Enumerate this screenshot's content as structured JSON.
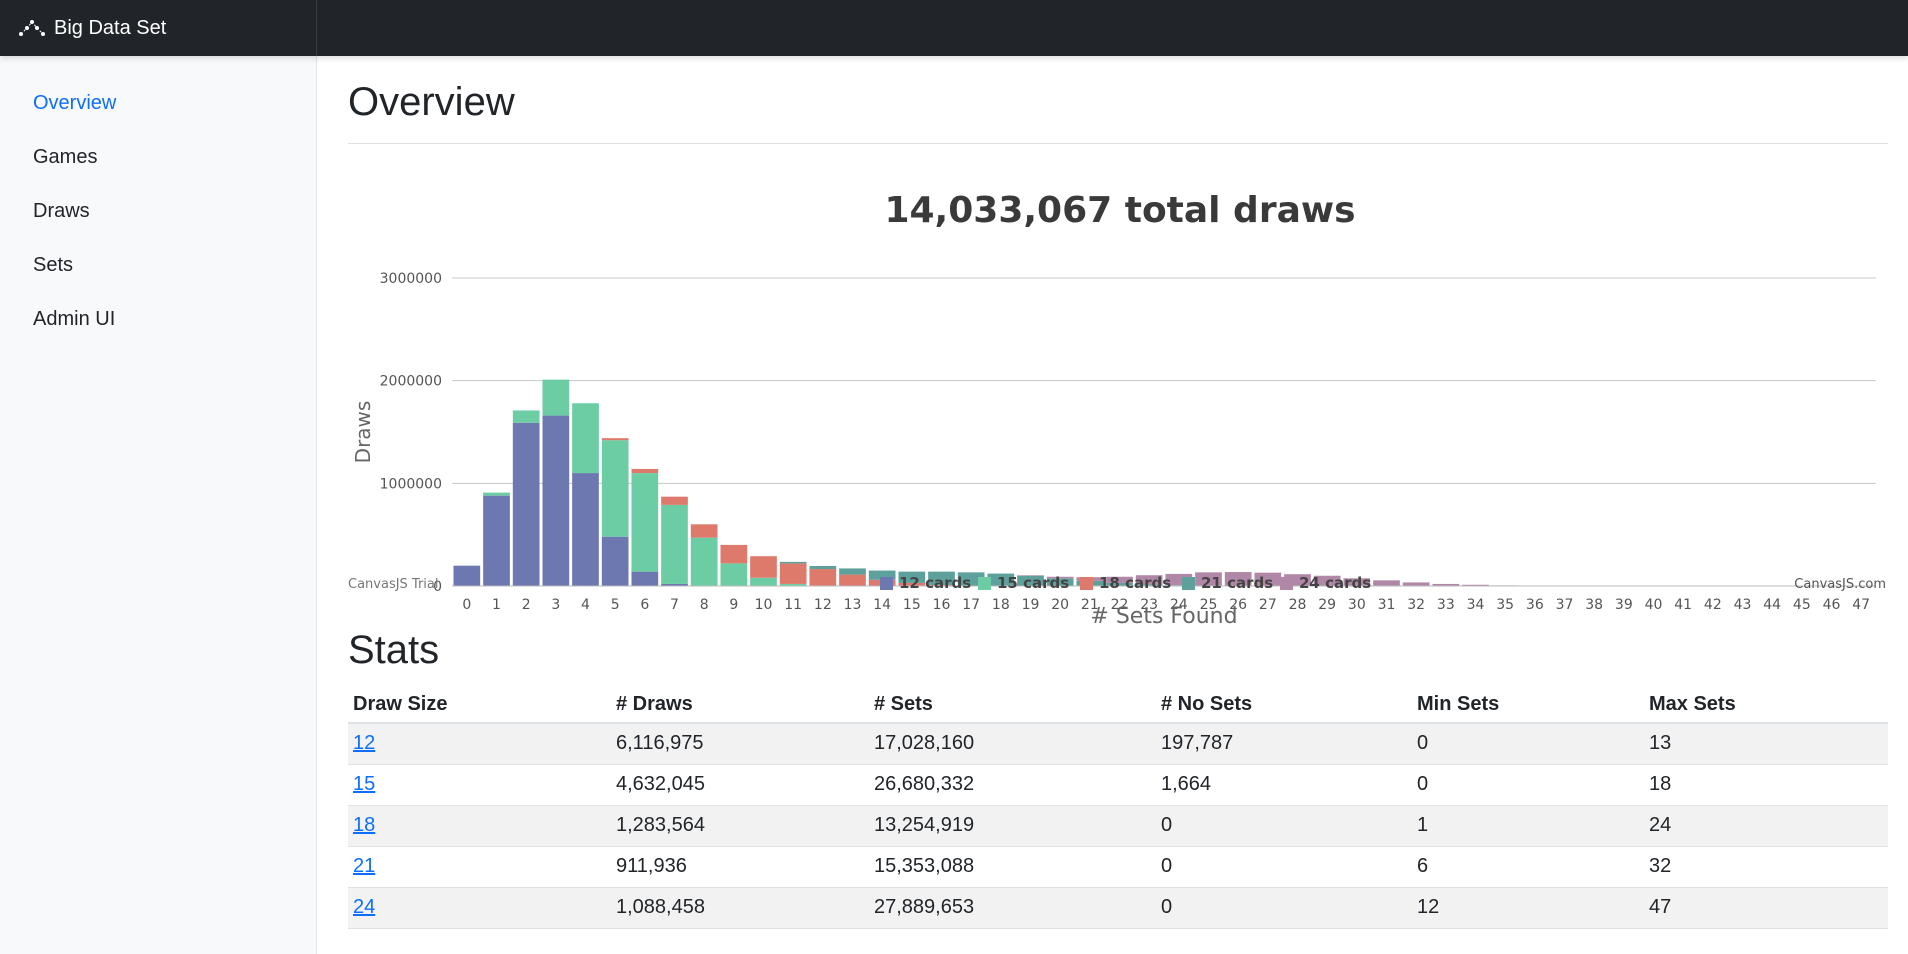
{
  "app": {
    "brand": "Big Data Set"
  },
  "sidebar": {
    "items": [
      {
        "label": "Overview",
        "active": true
      },
      {
        "label": "Games"
      },
      {
        "label": "Draws"
      },
      {
        "label": "Sets"
      },
      {
        "label": "Admin UI"
      }
    ]
  },
  "main": {
    "title": "Overview",
    "stats_title": "Stats"
  },
  "chart_data": {
    "type": "bar",
    "stacked": true,
    "title": "14,033,067 total draws",
    "xlabel": "# Sets Found",
    "ylabel": "Draws",
    "ylim": [
      0,
      3000000
    ],
    "yticks": [
      "0",
      "1000000",
      "2000000",
      "3000000"
    ],
    "grid": true,
    "legend_position": "bottom-center",
    "watermark_left": "CanvasJS Trial",
    "watermark_right": "CanvasJS.com",
    "categories": [
      "0",
      "1",
      "2",
      "3",
      "4",
      "5",
      "6",
      "7",
      "8",
      "9",
      "10",
      "11",
      "12",
      "13",
      "14",
      "15",
      "16",
      "17",
      "18",
      "19",
      "20",
      "21",
      "22",
      "23",
      "24",
      "25",
      "26",
      "27",
      "28",
      "29",
      "30",
      "31",
      "32",
      "33",
      "34",
      "35",
      "36",
      "37",
      "38",
      "39",
      "40",
      "41",
      "42",
      "43",
      "44",
      "45",
      "46",
      "47"
    ],
    "series": [
      {
        "name": "12 cards",
        "color": "#6d78b0",
        "values": [
          198000,
          880000,
          1590000,
          1660000,
          1100000,
          480000,
          140000,
          20000,
          1000,
          500,
          200,
          100,
          50,
          20,
          0,
          0,
          0,
          0,
          0,
          0,
          0,
          0,
          0,
          0,
          0,
          0,
          0,
          0,
          0,
          0,
          0,
          0,
          0,
          0,
          0,
          0,
          0,
          0,
          0,
          0,
          0,
          0,
          0,
          0,
          0,
          0,
          0,
          0
        ]
      },
      {
        "name": "15 cards",
        "color": "#6ccca4",
        "values": [
          0,
          30000,
          120000,
          350000,
          680000,
          940000,
          960000,
          770000,
          470000,
          220000,
          80000,
          20000,
          5000,
          1000,
          500,
          0,
          0,
          0,
          0,
          0,
          0,
          0,
          0,
          0,
          0,
          0,
          0,
          0,
          0,
          0,
          0,
          0,
          0,
          0,
          0,
          0,
          0,
          0,
          0,
          0,
          0,
          0,
          0,
          0,
          0,
          0,
          0,
          0
        ]
      },
      {
        "name": "18 cards",
        "color": "#dd7a6c",
        "values": [
          0,
          0,
          0,
          0,
          0,
          20000,
          40000,
          80000,
          130000,
          180000,
          210000,
          200000,
          160000,
          110000,
          60000,
          30000,
          10000,
          3000,
          1000,
          0,
          0,
          0,
          0,
          0,
          0,
          0,
          0,
          0,
          0,
          0,
          0,
          0,
          0,
          0,
          0,
          0,
          0,
          0,
          0,
          0,
          0,
          0,
          0,
          0,
          0,
          0,
          0,
          0
        ]
      },
      {
        "name": "21 cards",
        "color": "#5ea09c",
        "values": [
          0,
          0,
          0,
          0,
          0,
          0,
          0,
          0,
          0,
          0,
          0,
          15000,
          30000,
          60000,
          90000,
          110000,
          130000,
          130000,
          120000,
          100000,
          75000,
          50000,
          30000,
          15000,
          8000,
          3000,
          1000,
          0,
          0,
          0,
          0,
          0,
          0,
          0,
          0,
          0,
          0,
          0,
          0,
          0,
          0,
          0,
          0,
          0,
          0,
          0,
          0,
          0
        ]
      },
      {
        "name": "24 cards",
        "color": "#b087a6",
        "values": [
          0,
          0,
          0,
          0,
          0,
          0,
          0,
          0,
          0,
          0,
          0,
          0,
          0,
          0,
          0,
          0,
          0,
          0,
          0,
          5000,
          15000,
          35000,
          60000,
          90000,
          110000,
          130000,
          135000,
          130000,
          115000,
          100000,
          75000,
          55000,
          35000,
          20000,
          12000,
          6000,
          3000,
          1500,
          700,
          300,
          150,
          80,
          40,
          20,
          10,
          5,
          2,
          1
        ]
      }
    ]
  },
  "stats": {
    "headers": [
      "Draw Size",
      "# Draws",
      "# Sets",
      "# No Sets",
      "Min Sets",
      "Max Sets"
    ],
    "rows": [
      [
        "12",
        "6,116,975",
        "17,028,160",
        "197,787",
        "0",
        "13"
      ],
      [
        "15",
        "4,632,045",
        "26,680,332",
        "1,664",
        "0",
        "18"
      ],
      [
        "18",
        "1,283,564",
        "13,254,919",
        "0",
        "1",
        "24"
      ],
      [
        "21",
        "911,936",
        "15,353,088",
        "0",
        "6",
        "32"
      ],
      [
        "24",
        "1,088,458",
        "27,889,653",
        "0",
        "12",
        "47"
      ]
    ]
  }
}
